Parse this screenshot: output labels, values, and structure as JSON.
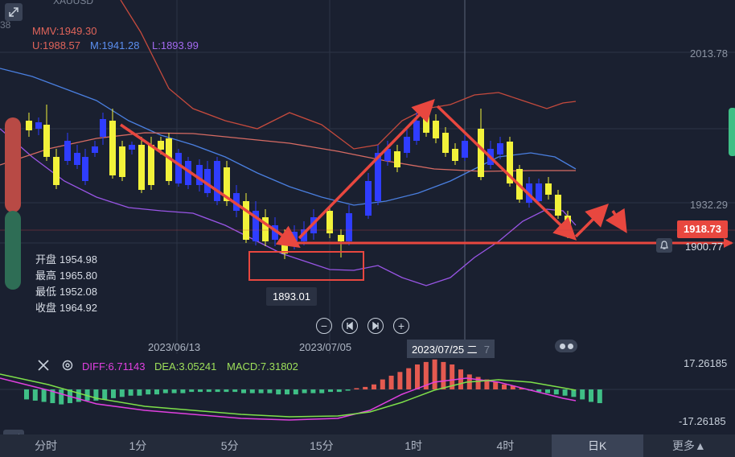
{
  "header": {
    "symbol": "XAUUSD",
    "tab_a": "日",
    "tab_b": "K"
  },
  "indicators": {
    "mmv": "MMV:1949.30",
    "upper": "U:1988.57",
    "middle": "M:1941.28",
    "lower": "L:1893.99"
  },
  "price_axis": {
    "top_partial": "38",
    "level_1": "2013.78",
    "level_2": "1932.29",
    "current": "1918.73",
    "current_partial": "1900.77"
  },
  "ohlc": {
    "open_label": "开盘",
    "open_value": "1954.98",
    "high_label": "最高",
    "high_value": "1965.80",
    "low_label": "最低",
    "low_value": "1952.08",
    "close_label": "收盘",
    "close_value": "1964.92"
  },
  "low_marker": "1893.01",
  "dates": {
    "d1": "2023/06/13",
    "d2": "2023/07/05",
    "d3": "2023/07/25 二",
    "d3_extra": "7"
  },
  "macd": {
    "diff": "DIFF:6.71143",
    "dea": "DEA:3.05241",
    "macd": "MACD:7.31802",
    "top": "17.26185",
    "bottom": "-17.26185"
  },
  "timeframes": [
    "分时",
    "1分",
    "5分",
    "15分",
    "1时",
    "4时",
    "日K",
    "更多▲"
  ],
  "active_timeframe": "日K",
  "colors": {
    "background": "#1a2030",
    "up_candle": "#f2f23a",
    "down_candle": "#2f3dff",
    "upper_band": "#c54a3d",
    "middle_band": "#4a7fe0",
    "lower_band": "#9955e6",
    "ma_long": "#d76b63",
    "arrow": "#e8473f",
    "macd_pos": "#e45a50",
    "macd_neg": "#3fbf86",
    "diff_line": "#e040e0",
    "dea_line": "#7ee04a"
  }
}
